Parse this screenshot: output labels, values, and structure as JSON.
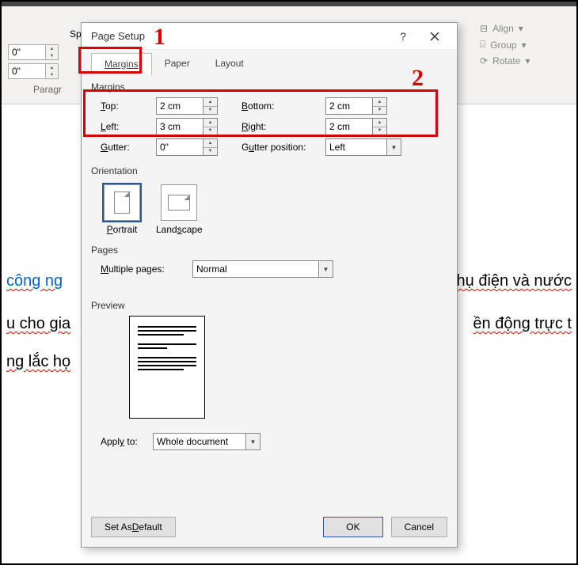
{
  "ribbon": {
    "spacing": {
      "label": "Sp",
      "field1": "0\"",
      "field2": "0\""
    },
    "paragraph_label": "Paragr",
    "arrange": {
      "align": "Align",
      "group": "Group",
      "rotate": "Rotate"
    }
  },
  "doc": {
    "line1_blue": "công ng",
    "line1_end": "hụ điện và nước",
    "line2_start": "u cho gia",
    "line2_end": "ền động trực t",
    "line3_start": "ng lắc họ"
  },
  "dialog": {
    "title": "Page Setup",
    "help": "?",
    "tabs": {
      "margins": "Margins",
      "paper": "Paper",
      "layout": "Layout"
    },
    "sections": {
      "margins": "Margins",
      "orientation": "Orientation",
      "pages": "Pages",
      "preview": "Preview"
    },
    "fields": {
      "top": {
        "label": "Top:",
        "value": "2 cm"
      },
      "bottom": {
        "label": "Bottom:",
        "value": "2 cm"
      },
      "left": {
        "label": "Left:",
        "value": "3 cm"
      },
      "right": {
        "label": "Right:",
        "value": "2 cm"
      },
      "gutter": {
        "label": "Gutter:",
        "value": "0\""
      },
      "gutter_pos": {
        "label": "Gutter position:",
        "value": "Left"
      },
      "multiple_pages": {
        "label": "Multiple pages:",
        "value": "Normal"
      },
      "apply_to": {
        "label": "Apply to:",
        "value": "Whole document"
      }
    },
    "orientation": {
      "portrait": "Portrait",
      "landscape": "Landscape"
    },
    "buttons": {
      "default": "Set As Default",
      "ok": "OK",
      "cancel": "Cancel"
    }
  },
  "annotations": {
    "one": "1",
    "two": "2"
  }
}
